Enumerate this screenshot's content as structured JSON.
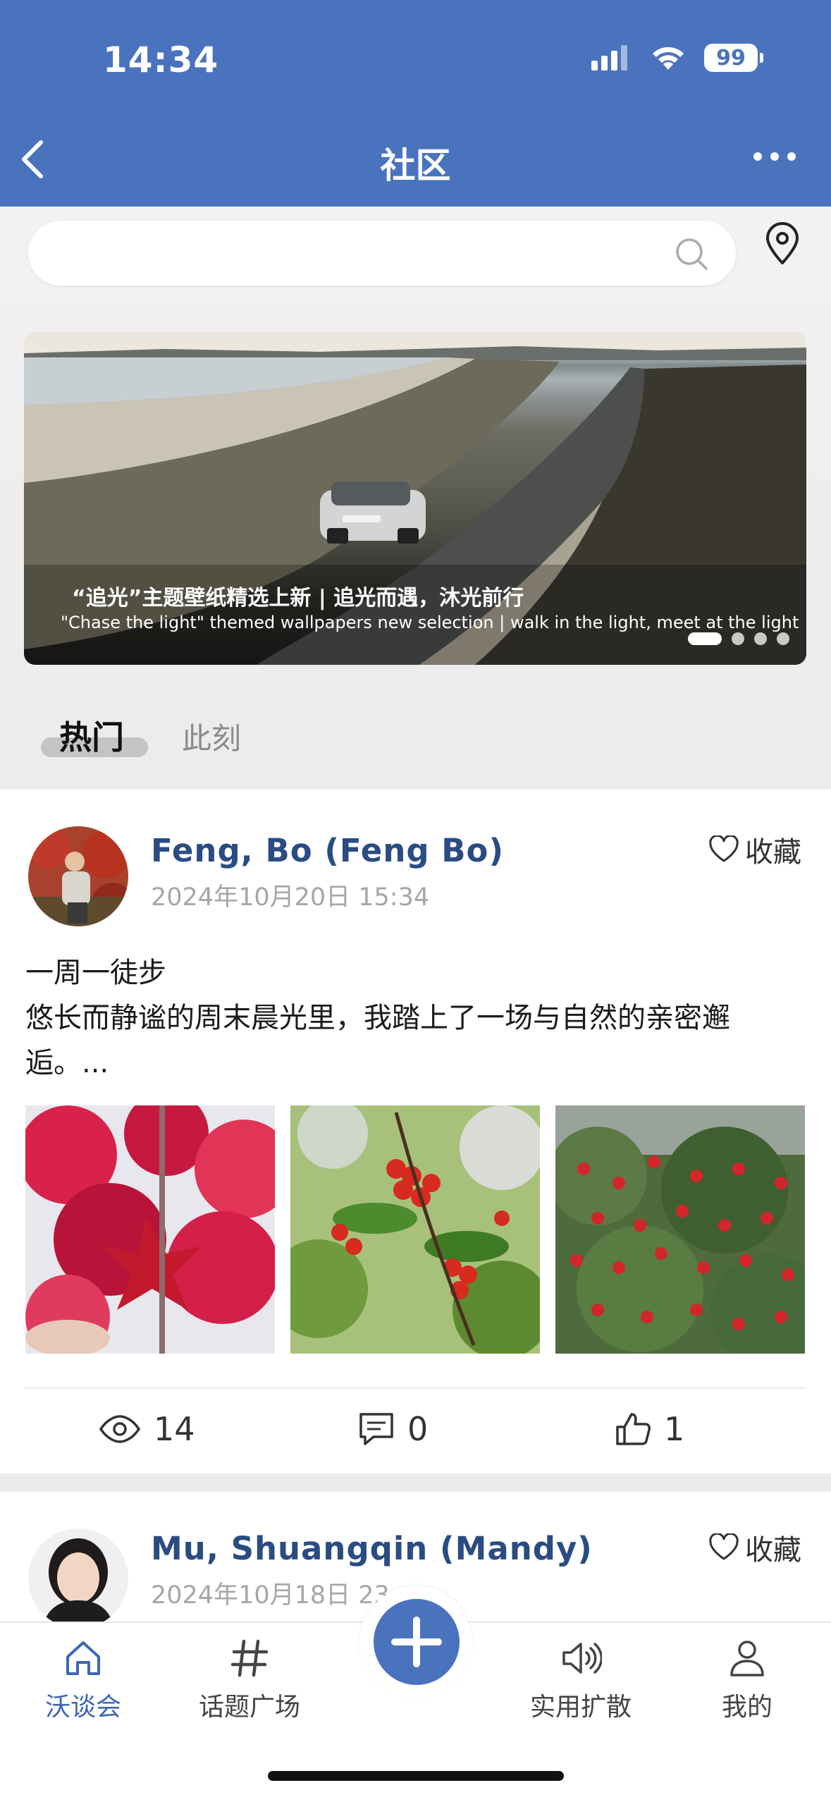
{
  "status_bar": {
    "time": "14:34",
    "battery": "99"
  },
  "nav": {
    "title": "社区"
  },
  "search": {
    "placeholder": ""
  },
  "banner": {
    "title": "“追光”主题壁纸精选上新 | 追光而遇，沐光前行",
    "subtitle": "\"Chase the light\" themed wallpapers new selection | walk in the light, meet at the light",
    "page_count": 4,
    "active_page": 1
  },
  "tabs": [
    {
      "label": "热门",
      "active": true
    },
    {
      "label": "此刻",
      "active": false
    }
  ],
  "posts": [
    {
      "author": "Feng, Bo (Feng Bo)",
      "date": "2024年10月20日 15:34",
      "favorite_label": "收藏",
      "content_line1": "一周一徒步",
      "content_line2": "悠长而静谧的周末晨光里，我踏上了一场与自然的亲密邂逅。...",
      "stats": {
        "views": "14",
        "comments": "0",
        "likes": "1"
      }
    },
    {
      "author": "Mu, Shuangqin (Mandy)",
      "date": "2024年10月18日 23",
      "favorite_label": "收藏"
    }
  ],
  "bottom_nav": [
    {
      "label": "沃谈会",
      "icon": "home-icon",
      "active": true
    },
    {
      "label": "话题广场",
      "icon": "hashtag-icon",
      "active": false
    },
    {
      "label": "",
      "icon": "plus-icon",
      "active": false
    },
    {
      "label": "实用扩散",
      "icon": "speaker-icon",
      "active": false
    },
    {
      "label": "我的",
      "icon": "person-icon",
      "active": false
    }
  ],
  "colors": {
    "brand": "#4a73be",
    "author": "#2a4c82"
  }
}
